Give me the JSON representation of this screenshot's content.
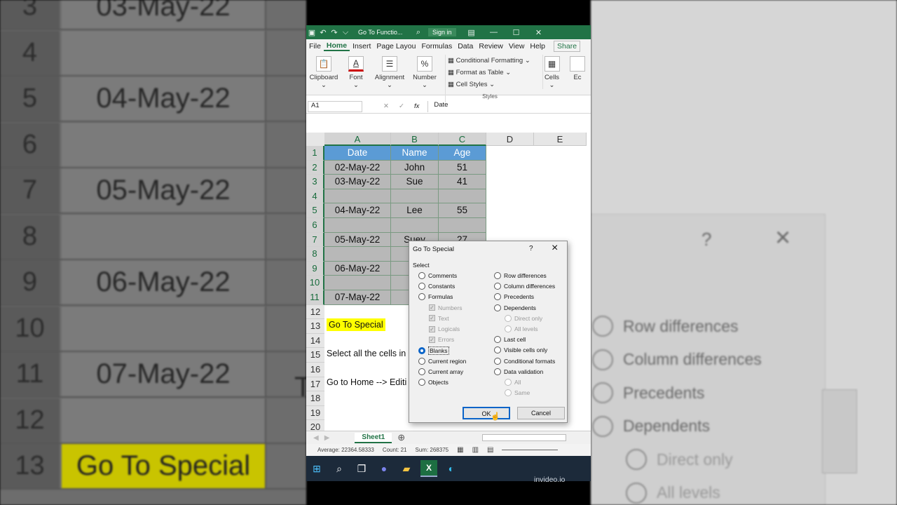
{
  "window": {
    "title": "Go To Functio...",
    "search_icon": "search-icon",
    "sign_in": "Sign in"
  },
  "menu": [
    "File",
    "Home",
    "Insert",
    "Page Layou",
    "Formulas",
    "Data",
    "Review",
    "View",
    "Help"
  ],
  "share_label": "Share",
  "ribbon": {
    "clipboard": "Clipboard",
    "font": "Font",
    "alignment": "Alignment",
    "number": "Number",
    "conditional": "Conditional Formatting",
    "format_table": "Format as Table",
    "cell_styles": "Cell Styles",
    "styles": "Styles",
    "cells": "Cells",
    "editing": "Ec"
  },
  "formula_bar": {
    "namebox": "A1",
    "fx": "fx",
    "content": "Date"
  },
  "columns": [
    "A",
    "B",
    "C",
    "D",
    "E"
  ],
  "rows": [
    "1",
    "2",
    "3",
    "4",
    "5",
    "6",
    "7",
    "8",
    "9",
    "10",
    "11",
    "12",
    "13",
    "14",
    "15",
    "16",
    "17",
    "18",
    "19",
    "20"
  ],
  "table": {
    "headers": [
      "Date",
      "Name",
      "Age"
    ],
    "data": [
      [
        "02-May-22",
        "John",
        "51"
      ],
      [
        "03-May-22",
        "Sue",
        "41"
      ],
      [
        "",
        "",
        ""
      ],
      [
        "04-May-22",
        "Lee",
        "55"
      ],
      [
        "",
        "",
        ""
      ],
      [
        "05-May-22",
        "Suey",
        "27"
      ],
      [
        "",
        "",
        ""
      ],
      [
        "06-May-22",
        "L",
        ""
      ],
      [
        "",
        "",
        ""
      ],
      [
        "07-May-22",
        "Tr",
        ""
      ]
    ]
  },
  "notes": {
    "r13": "Go To Special",
    "r15": "Select all the cells in",
    "r17": "Go to Home --> Editi"
  },
  "sheet_tab": "Sheet1",
  "status": {
    "average": "Average: 22364.58333",
    "count": "Count: 21",
    "sum": "Sum: 268375"
  },
  "dialog": {
    "title": "Go To Special",
    "help": "?",
    "close": "×",
    "group": "Select",
    "left": [
      "Comments",
      "Constants",
      "Formulas",
      "Numbers",
      "Text",
      "Logicals",
      "Errors",
      "Blanks",
      "Current region",
      "Current array",
      "Objects"
    ],
    "right": [
      "Row differences",
      "Column differences",
      "Precedents",
      "Dependents",
      "Direct only",
      "All levels",
      "Last cell",
      "Visible cells only",
      "Conditional formats",
      "Data validation",
      "All",
      "Same"
    ],
    "selected": "Blanks",
    "ok": "OK",
    "cancel": "Cancel"
  },
  "bg": {
    "left_rows": [
      "3",
      "4",
      "5",
      "6",
      "7",
      "8",
      "9",
      "10",
      "11",
      "12",
      "13"
    ],
    "left_dates": [
      "03-May-22",
      "",
      "04-May-22",
      "",
      "05-May-22",
      "",
      "06-May-22",
      "",
      "07-May-22",
      "",
      "Go To Special"
    ],
    "left_extra": "T",
    "right_help": "?",
    "right_close": "×",
    "right_opts": [
      "Row differences",
      "Column differences",
      "Precedents",
      "Dependents",
      "Direct only",
      "All levels"
    ],
    "right_small_close": "×"
  },
  "watermark": "invideo.io"
}
